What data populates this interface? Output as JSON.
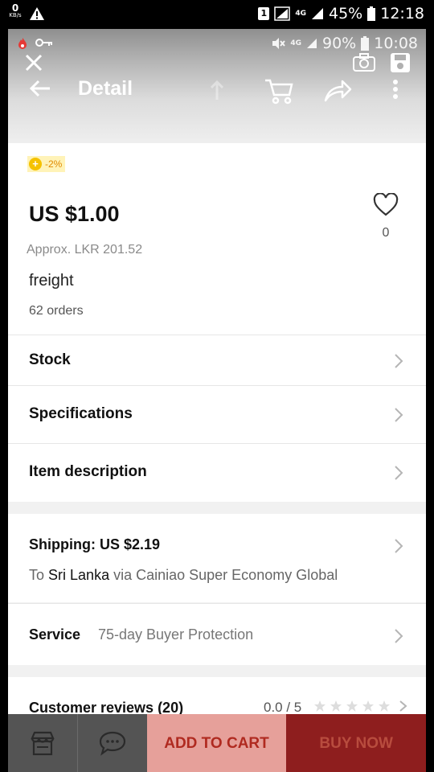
{
  "outer_status": {
    "speed_value": "0",
    "speed_unit": "KB/s",
    "sim_slot": "1",
    "network": "4G",
    "battery": "45%",
    "time": "12:18"
  },
  "inner_status": {
    "network": "4G",
    "battery": "90%",
    "time": "10:08"
  },
  "header": {
    "title": "Detail"
  },
  "product": {
    "discount_badge": "-2%",
    "price": "US $1.00",
    "approx_price": "Approx. LKR 201.52",
    "freight": "freight",
    "orders": "62 orders",
    "wishlist_count": "0"
  },
  "menu_rows": {
    "stock": "Stock",
    "specifications": "Specifications",
    "item_description": "Item description"
  },
  "shipping": {
    "label": "Shipping: US $2.19",
    "to_word": "To",
    "destination": "Sri Lanka",
    "via_text": "via Cainiao Super Economy Global"
  },
  "service": {
    "label": "Service",
    "value": "75-day Buyer Protection"
  },
  "reviews": {
    "label": "Customer reviews (20)",
    "score": "0.0 / 5",
    "rating": 0
  },
  "bottom_bar": {
    "add_to_cart": "ADD TO CART",
    "buy_now": "BUY NOW"
  },
  "colors": {
    "accent_price": "#111111",
    "add_to_cart_bg": "#e6a09a",
    "buy_now_bg": "#8e1e1e",
    "discount_bg": "#fff3b8"
  },
  "icons": {
    "close": "close-icon",
    "camera": "camera-icon",
    "save": "save-icon",
    "back": "back-arrow-icon",
    "cart": "cart-icon",
    "share": "share-icon",
    "more": "more-vertical-icon",
    "wishlist": "heart-icon",
    "store": "store-icon",
    "chat": "chat-icon"
  }
}
